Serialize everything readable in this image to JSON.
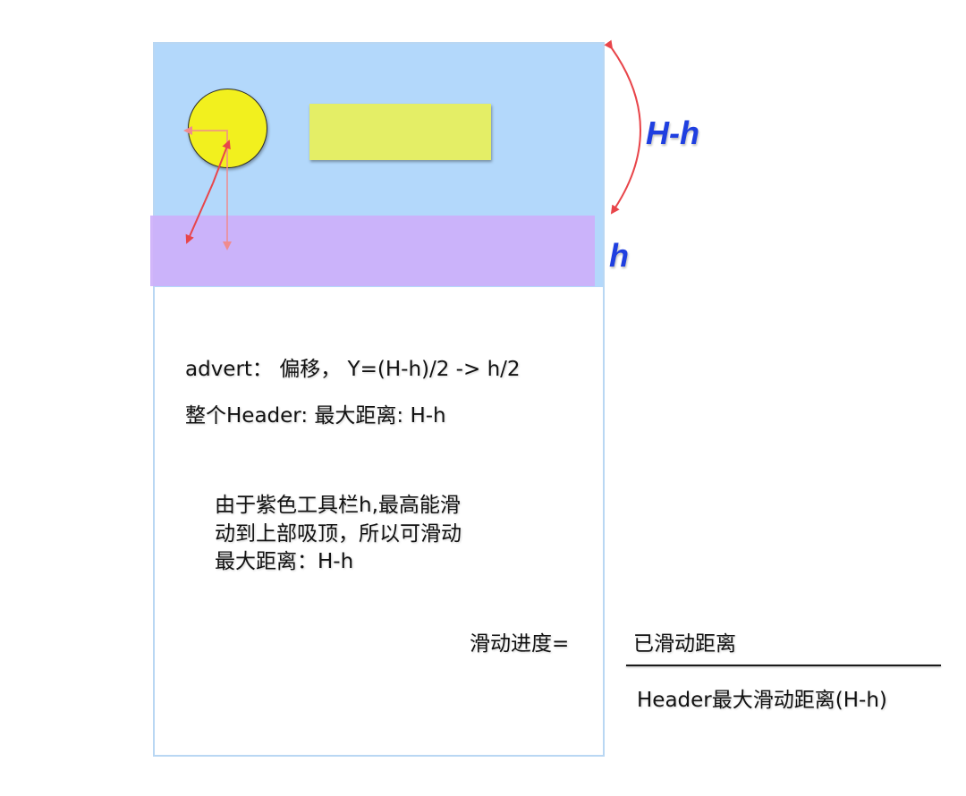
{
  "dimensions": {
    "upper_label": "H-h",
    "toolbar_label": "h"
  },
  "notes": {
    "advert_offset": "advert： 偏移， Y=(H-h)/2  -> h/2",
    "header_max": "整个Header: 最大距离: H-h",
    "explanation_lines": [
      "由于紫色工具栏h,最高能滑",
      "动到上部吸顶，所以可滑动",
      "最大距离：H-h"
    ]
  },
  "formula": {
    "label": "滑动进度=",
    "numerator": "已滑动距离",
    "denominator": "Header最大滑动距离(H-h)"
  },
  "colors": {
    "header_background": "#b3d8fb",
    "toolbar": "#cdb0fa",
    "avatar": "#f2f01e",
    "advert_block": "#e4ee66",
    "arrow": "#e8454a",
    "dimension_text": "#1f3fe0"
  }
}
